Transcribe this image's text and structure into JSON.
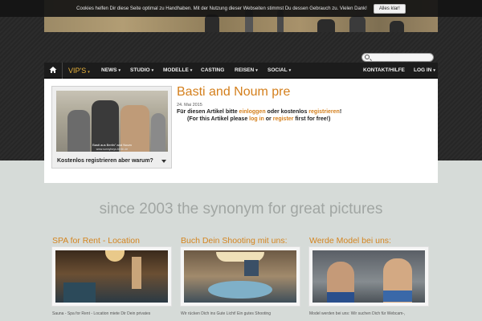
{
  "cookie": {
    "text": "Cookies helfen Dir diese Seite optimal zu Handhaben. Mit der Nutzung dieser Webseiten stimmst Du dessen Gebrauch zu. Vielen Dank!",
    "button": "Alles klar!"
  },
  "nav": {
    "items": [
      {
        "label": "VIP'S",
        "caret": "▾"
      },
      {
        "label": "NEWS",
        "caret": "▾"
      },
      {
        "label": "STUDIO",
        "caret": "▾"
      },
      {
        "label": "MODELLE",
        "caret": "▾"
      },
      {
        "label": "CASTING",
        "caret": ""
      },
      {
        "label": "REISEN",
        "caret": "▾"
      },
      {
        "label": "SOCIAL",
        "caret": "▾"
      },
      {
        "label": "KONTAKT/HILFE",
        "caret": ""
      },
      {
        "label": "LOG IN",
        "caret": "▾"
      }
    ]
  },
  "sidebar": {
    "photo_caption": "Basti aus Berlin\" and Noum",
    "photo_subcaption": "www.sunnyboys.berlin.de",
    "dropdown_label": "Kostenlos registrieren aber warum?"
  },
  "article": {
    "title": "Basti and Noum pre",
    "date": "24. Mai 2015",
    "line1_prefix": "Für diesen Artikel bitte ",
    "line1_link1": "einloggen",
    "line1_middle": " oder kostenlos ",
    "line1_link2": "registrieren",
    "line1_suffix": "!",
    "line2_prefix": "(For this Artikel please ",
    "line2_link1": "log in",
    "line2_middle": " or ",
    "line2_link2": "register",
    "line2_suffix": " first for free!)"
  },
  "tagline": "since 2003 the synonym for great pictures",
  "cards": [
    {
      "title": "SPA for Rent - Location",
      "text": "Sauna - Spa for Rent - Location miete Dir Dein privates"
    },
    {
      "title": "Buch Dein Shooting mit uns:",
      "text": "Wir rücken Dich ins Gute Licht! Ein gutes Shooting"
    },
    {
      "title": "Werde Model bei uns:",
      "text": "Model werden bei uns: Wir suchen Dich für Webcam-,"
    }
  ],
  "colors": {
    "accent": "#d47f1c",
    "nav_bg": "#1c1c1c",
    "page_bg": "#d6dbd8"
  }
}
